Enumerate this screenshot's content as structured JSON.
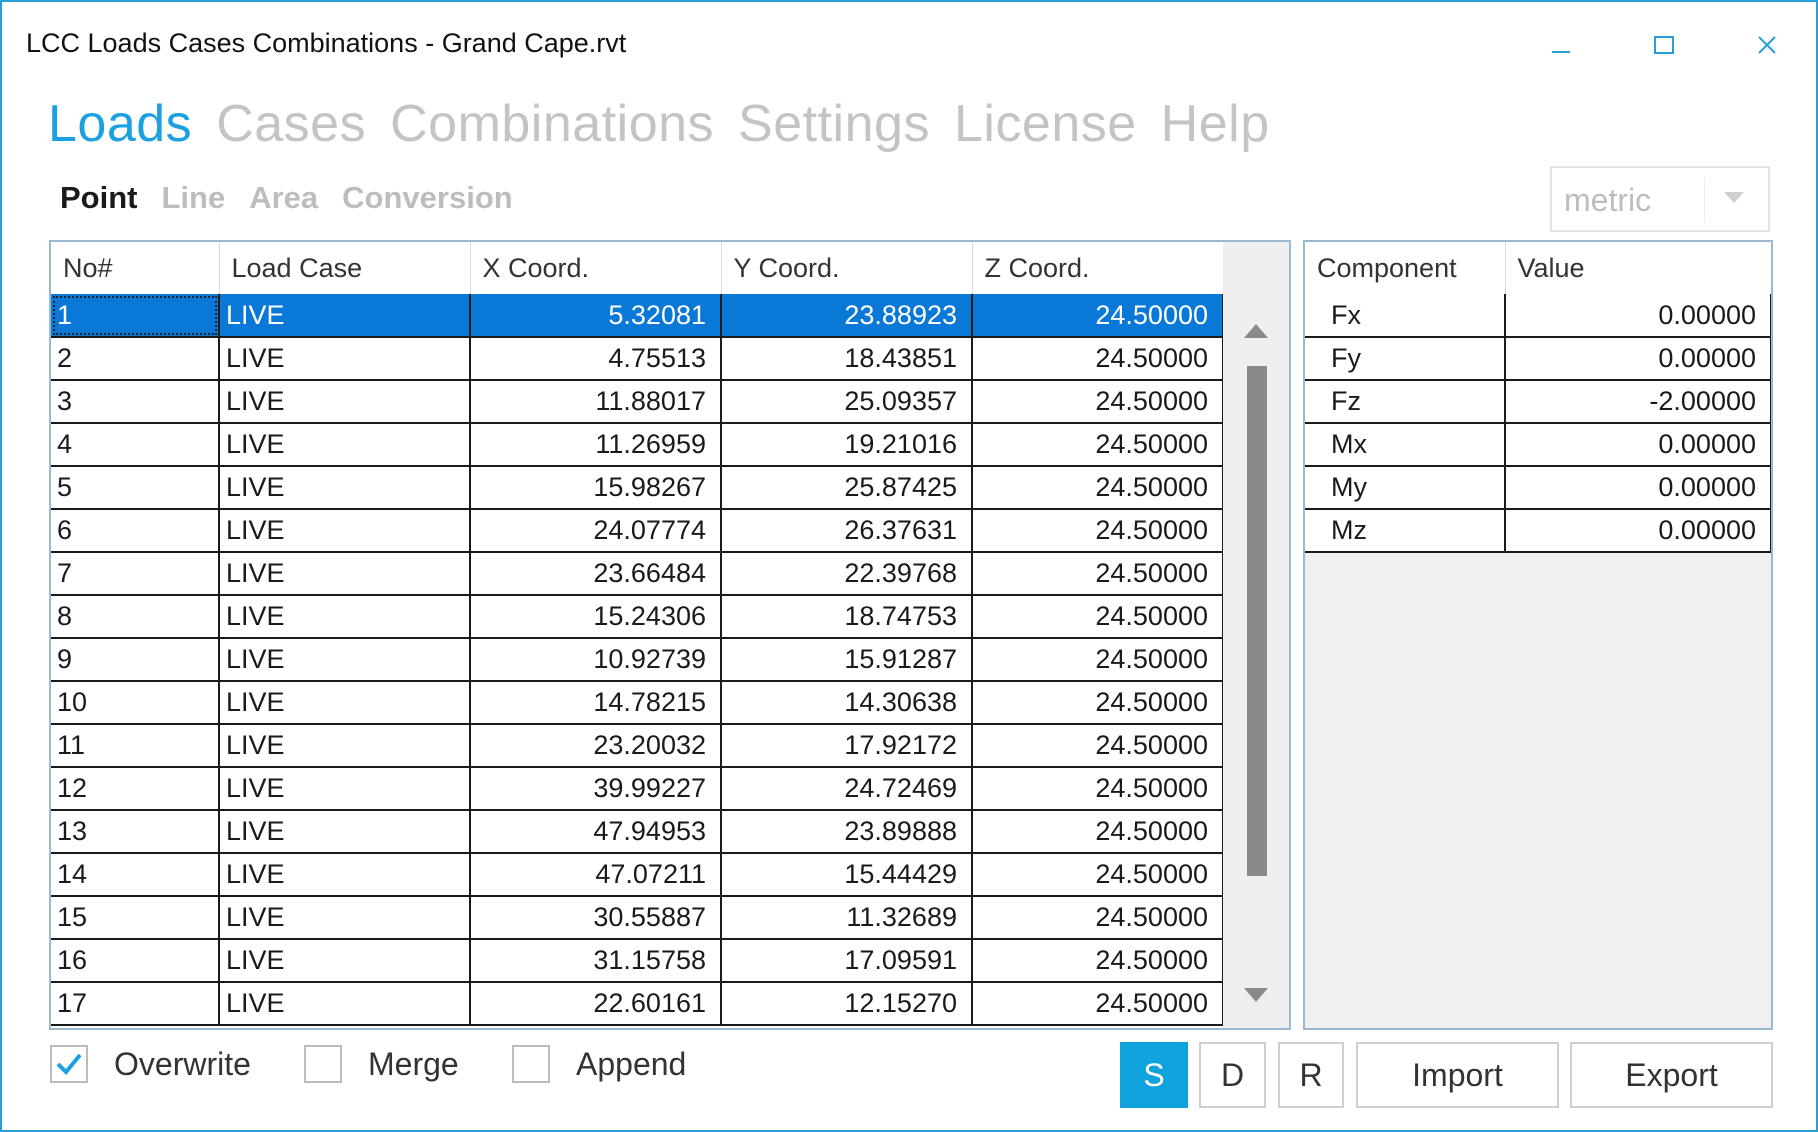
{
  "window": {
    "title": "LCC Loads Cases Combinations - Grand Cape.rvt",
    "accent": "#1ba1e2"
  },
  "main_nav": [
    {
      "label": "Loads",
      "active": true
    },
    {
      "label": "Cases",
      "active": false
    },
    {
      "label": "Combinations",
      "active": false
    },
    {
      "label": "Settings",
      "active": false
    },
    {
      "label": "License",
      "active": false
    },
    {
      "label": "Help",
      "active": false
    }
  ],
  "sub_nav": [
    {
      "label": "Point",
      "active": true
    },
    {
      "label": "Line",
      "active": false
    },
    {
      "label": "Area",
      "active": false
    },
    {
      "label": "Conversion",
      "active": false
    }
  ],
  "unit_select": {
    "value": "metric"
  },
  "loads_table": {
    "columns": [
      "No#",
      "Load Case",
      "X Coord.",
      "Y Coord.",
      "Z Coord."
    ],
    "selected_row": 0,
    "rows": [
      [
        "1",
        "LIVE",
        "5.32081",
        "23.88923",
        "24.50000"
      ],
      [
        "2",
        "LIVE",
        "4.75513",
        "18.43851",
        "24.50000"
      ],
      [
        "3",
        "LIVE",
        "11.88017",
        "25.09357",
        "24.50000"
      ],
      [
        "4",
        "LIVE",
        "11.26959",
        "19.21016",
        "24.50000"
      ],
      [
        "5",
        "LIVE",
        "15.98267",
        "25.87425",
        "24.50000"
      ],
      [
        "6",
        "LIVE",
        "24.07774",
        "26.37631",
        "24.50000"
      ],
      [
        "7",
        "LIVE",
        "23.66484",
        "22.39768",
        "24.50000"
      ],
      [
        "8",
        "LIVE",
        "15.24306",
        "18.74753",
        "24.50000"
      ],
      [
        "9",
        "LIVE",
        "10.92739",
        "15.91287",
        "24.50000"
      ],
      [
        "10",
        "LIVE",
        "14.78215",
        "14.30638",
        "24.50000"
      ],
      [
        "11",
        "LIVE",
        "23.20032",
        "17.92172",
        "24.50000"
      ],
      [
        "12",
        "LIVE",
        "39.99227",
        "24.72469",
        "24.50000"
      ],
      [
        "13",
        "LIVE",
        "47.94953",
        "23.89888",
        "24.50000"
      ],
      [
        "14",
        "LIVE",
        "47.07211",
        "15.44429",
        "24.50000"
      ],
      [
        "15",
        "LIVE",
        "30.55887",
        "11.32689",
        "24.50000"
      ],
      [
        "16",
        "LIVE",
        "31.15758",
        "17.09591",
        "24.50000"
      ],
      [
        "17",
        "LIVE",
        "22.60161",
        "12.15270",
        "24.50000"
      ]
    ]
  },
  "component_table": {
    "columns": [
      "Component",
      "Value"
    ],
    "rows": [
      [
        "Fx",
        "0.00000"
      ],
      [
        "Fy",
        "0.00000"
      ],
      [
        "Fz",
        "-2.00000"
      ],
      [
        "Mx",
        "0.00000"
      ],
      [
        "My",
        "0.00000"
      ],
      [
        "Mz",
        "0.00000"
      ]
    ]
  },
  "options": [
    {
      "label": "Overwrite",
      "checked": true
    },
    {
      "label": "Merge",
      "checked": false
    },
    {
      "label": "Append",
      "checked": false
    }
  ],
  "buttons": {
    "s": "S",
    "d": "D",
    "r": "R",
    "import": "Import",
    "export": "Export"
  }
}
